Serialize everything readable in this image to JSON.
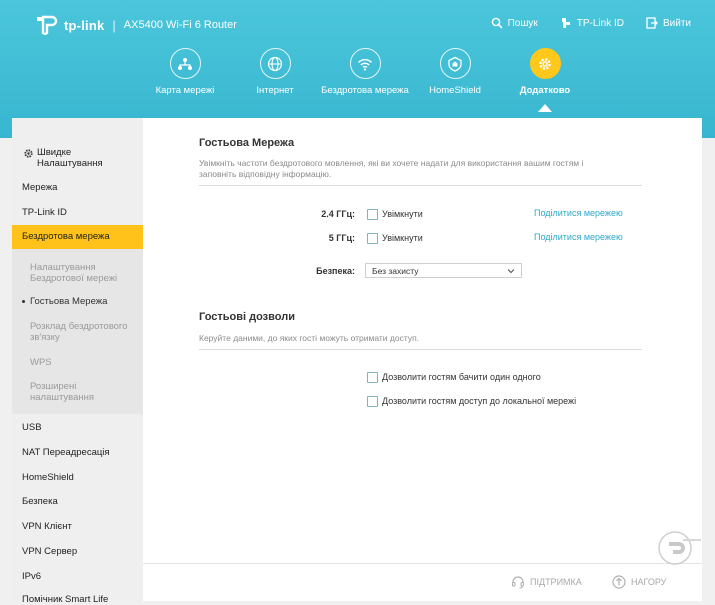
{
  "header": {
    "brand": "tp-link",
    "separator": "|",
    "model": "AX5400 Wi-Fi 6 Router",
    "actions": [
      {
        "label": "Пошук",
        "icon": "search-icon"
      },
      {
        "label": "TP-Link ID",
        "icon": "tplink-id-icon"
      },
      {
        "label": "Вийти",
        "icon": "logout-icon"
      }
    ]
  },
  "nav": [
    {
      "label": "Карта мережі",
      "icon": "network-map-icon"
    },
    {
      "label": "Інтернет",
      "icon": "globe-icon"
    },
    {
      "label": "Бездротова мережа",
      "icon": "wifi-icon"
    },
    {
      "label": "HomeShield",
      "icon": "home-shield-icon"
    },
    {
      "label": "Додатково",
      "icon": "gear-icon",
      "active": true
    }
  ],
  "sidebar": {
    "items": [
      {
        "label": "Швидке Налаштування",
        "icon": "quick-setup-icon"
      },
      {
        "label": "Мережа"
      },
      {
        "label": "TP-Link ID"
      },
      {
        "label": "Бездротова мережа",
        "active": true
      },
      {
        "label": "USB"
      },
      {
        "label": "NAT Переадресація"
      },
      {
        "label": "HomeShield"
      },
      {
        "label": "Безпека"
      },
      {
        "label": "VPN Клієнт"
      },
      {
        "label": "VPN Сервер"
      },
      {
        "label": "IPv6"
      },
      {
        "label": "Помічник Smart Life"
      }
    ],
    "subitems": [
      {
        "label": "Налаштування Бездротової мережі"
      },
      {
        "label": "Гостьова Мережа",
        "active": true
      },
      {
        "label": "Розклад бездротового зв'язку"
      },
      {
        "label": "WPS"
      },
      {
        "label": "Розширені налаштування"
      }
    ]
  },
  "guest": {
    "title": "Гостьова Мережа",
    "desc": "Увімкніть частоти бездротового мовлення, які ви хочете надати для використання вашим гостям і заповніть відповідну інформацію.",
    "bands": [
      {
        "label": "2.4 ГГц:",
        "enable": "Увімкнути",
        "share": "Поділитися мережею"
      },
      {
        "label": "5 ГГц:",
        "enable": "Увімкнути",
        "share": "Поділитися мережею"
      }
    ],
    "security_label": "Безпека:",
    "security_value": "Без захисту"
  },
  "permissions": {
    "title": "Гостьові дозволи",
    "desc": "Керуйте даними, до яких гості можуть отримати доступ.",
    "options": [
      {
        "label": "Дозволити гостям бачити один одного"
      },
      {
        "label": "Дозволити гостям доступ до локальної мережі"
      }
    ]
  },
  "footer": {
    "support": "ПІДТРИМКА",
    "top": "НАГОРУ"
  },
  "colors": {
    "header": "#3fbdd5",
    "accent": "#ffc21a",
    "link": "#2ea7c8"
  }
}
